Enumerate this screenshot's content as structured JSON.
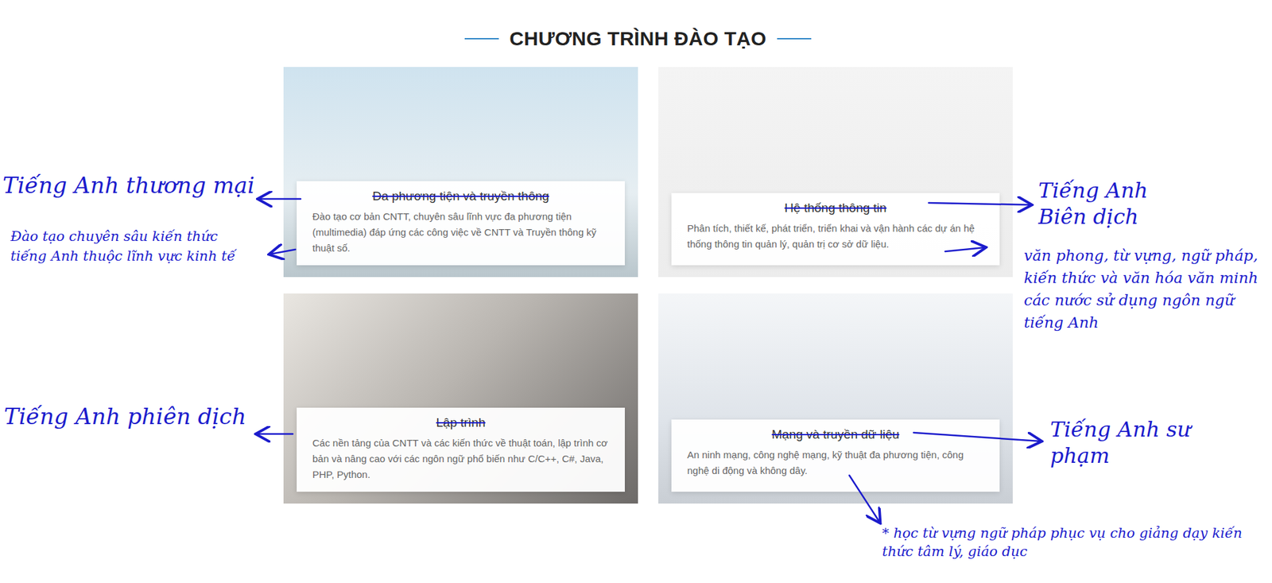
{
  "section": {
    "title": "CHƯƠNG TRÌNH ĐÀO TẠO"
  },
  "cards": [
    {
      "title": "Đa phương tiện và truyền thông",
      "description": "Đào tạo cơ bản CNTT, chuyên sâu lĩnh vực đa phương tiện (multimedia) đáp ứng các công việc về CNTT và Truyền thông kỹ thuật số.",
      "struck": true
    },
    {
      "title": "Hệ thống thông tin",
      "description": "Phân tích, thiết kế, phát triển, triển khai và vận hành các dự án hệ thống thông tin quản lý, quản trị cơ sở dữ liệu.",
      "struck": true
    },
    {
      "title": "Lập trình",
      "description": "Các nền tảng của CNTT và các kiến thức về thuật toán, lập trình cơ bản và nâng cao với các ngôn ngữ phổ biến như C/C++, C#, Java, PHP, Python.",
      "struck": true
    },
    {
      "title": "Mạng và truyền dữ liệu",
      "description": "An ninh mạng, công nghệ mạng, kỹ thuật đa phương tiện, công nghệ di động và không dây.",
      "struck": true
    }
  ],
  "annotations": [
    {
      "text": "Tiếng Anh thương mại"
    },
    {
      "text": "Đào tạo chuyên sâu kiến thức tiếng Anh thuộc lĩnh vực kinh tế"
    },
    {
      "text": "Tiếng Anh Biên dịch"
    },
    {
      "text": "văn phong, từ vựng, ngữ pháp, kiến thức và văn hóa văn minh các nước sử dụng ngôn ngữ tiếng Anh"
    },
    {
      "text": "Tiếng Anh phiên dịch"
    },
    {
      "text": "Tiếng Anh sư phạm"
    },
    {
      "text": "* học từ vựng ngữ pháp phục vụ cho giảng dạy kiến thức tâm lý, giáo dục"
    }
  ]
}
